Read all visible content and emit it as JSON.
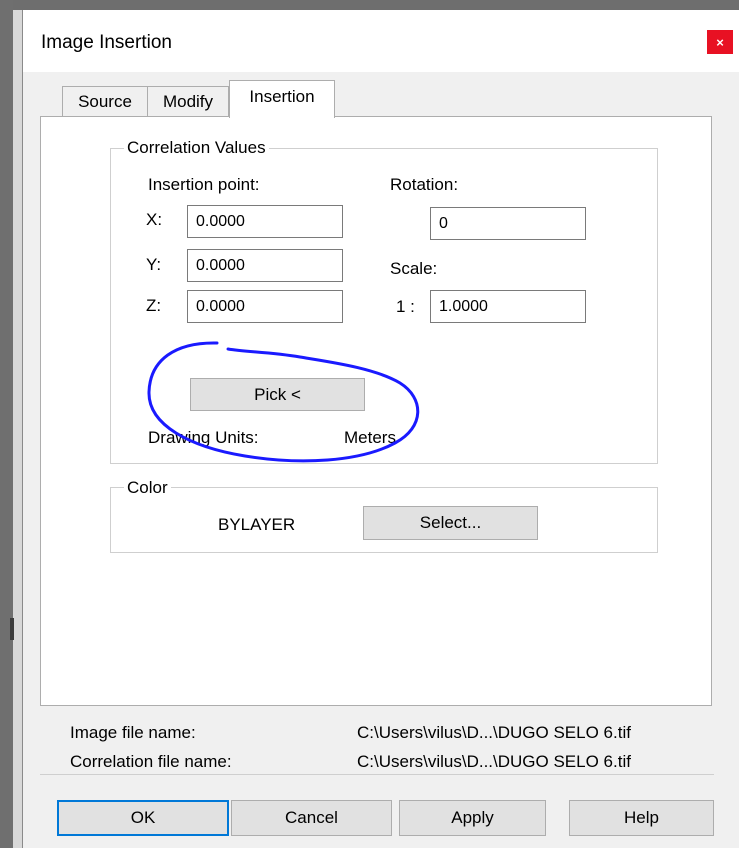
{
  "dialog": {
    "title": "Image Insertion",
    "close_glyph": "×"
  },
  "tabs": [
    {
      "label": "Source",
      "active": false
    },
    {
      "label": "Modify",
      "active": false
    },
    {
      "label": "Insertion",
      "active": true
    }
  ],
  "correlation": {
    "group_title": "Correlation Values",
    "insertion_point_label": "Insertion point:",
    "x_label": "X:",
    "x_value": "0.0000",
    "y_label": "Y:",
    "y_value": "0.0000",
    "z_label": "Z:",
    "z_value": "0.0000",
    "rotation_label": "Rotation:",
    "rotation_value": "0",
    "scale_label": "Scale:",
    "scale_prefix": "1 :",
    "scale_value": "1.0000",
    "pick_button": "Pick <",
    "drawing_units_label": "Drawing Units:",
    "drawing_units_value": "Meters"
  },
  "color": {
    "group_title": "Color",
    "value": "BYLAYER",
    "select_button": "Select..."
  },
  "files": {
    "image_label": "Image file name:",
    "image_value": "C:\\Users\\vilus\\D...\\DUGO SELO 6.tif",
    "correlation_label": "Correlation file name:",
    "correlation_value": "C:\\Users\\vilus\\D...\\DUGO SELO 6.tif"
  },
  "buttons": {
    "ok": "OK",
    "cancel": "Cancel",
    "apply": "Apply",
    "help": "Help"
  },
  "annotation": {
    "color": "#1a1aff",
    "icon": "hand-drawn-circle"
  },
  "colors": {
    "dialog_bg": "#f0f0f0",
    "close_red": "#e81123",
    "focus_blue": "#0078d7"
  }
}
